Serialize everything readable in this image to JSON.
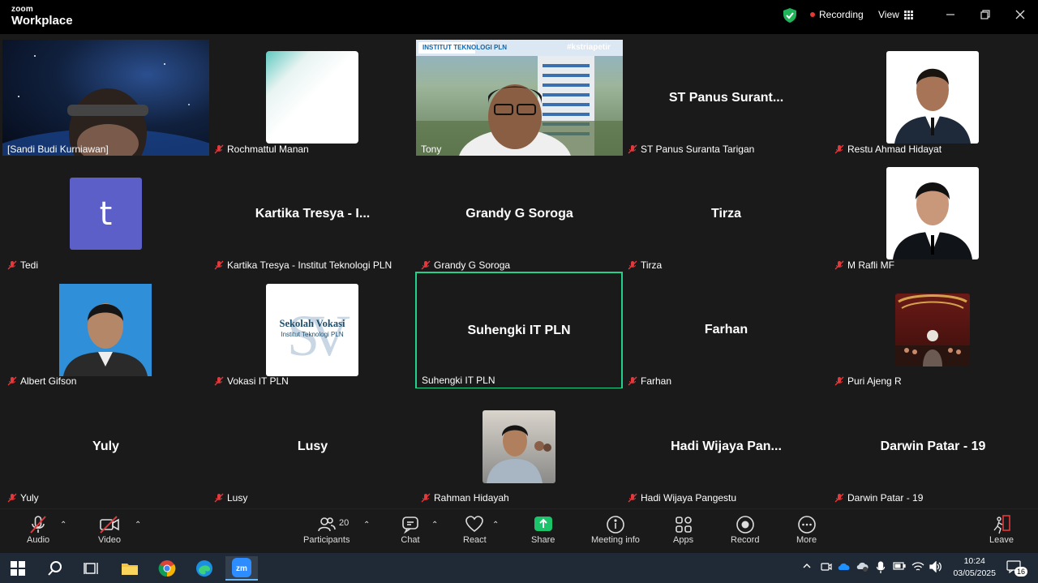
{
  "titlebar": {
    "brand_small": "zoom",
    "brand_large": "Workplace",
    "recording": "Recording",
    "view": "View"
  },
  "tiles": [
    {
      "name": "[Sandi Budi Kurniawan]",
      "big": "",
      "muted": false,
      "kind": "video-space"
    },
    {
      "name": "Rochmattul Manan",
      "big": "",
      "muted": true,
      "kind": "photo-white"
    },
    {
      "name": "Tony",
      "big": "",
      "muted": false,
      "kind": "video-building"
    },
    {
      "name": "ST Panus Suranta Tarigan",
      "big": "ST  Panus  Surant...",
      "muted": true,
      "kind": "name"
    },
    {
      "name": "Restu Ahmad Hidayat",
      "big": "",
      "muted": true,
      "kind": "photo-suit"
    },
    {
      "name": "Tedi",
      "big": "",
      "muted": true,
      "kind": "avatar",
      "avatar_letter": "t"
    },
    {
      "name": "Kartika Tresya - Institut Teknologi PLN",
      "big": "Kartika Tresya - I...",
      "muted": true,
      "kind": "name"
    },
    {
      "name": "Grandy G Soroga",
      "big": "Grandy G Soroga",
      "muted": true,
      "kind": "name"
    },
    {
      "name": "Tirza",
      "big": "Tirza",
      "muted": true,
      "kind": "name"
    },
    {
      "name": "M Rafli MF",
      "big": "",
      "muted": true,
      "kind": "photo-suit2"
    },
    {
      "name": "Albert Gifson",
      "big": "",
      "muted": true,
      "kind": "photo-blue"
    },
    {
      "name": "Vokasi IT PLN",
      "big": "",
      "muted": true,
      "kind": "logo-vokasi",
      "logo_line1": "Sekolah Vokasi",
      "logo_line2": "Institut Teknologi PLN"
    },
    {
      "name": "Suhengki IT PLN",
      "big": "Suhengki IT PLN",
      "muted": false,
      "kind": "name",
      "active": true
    },
    {
      "name": "Farhan",
      "big": "Farhan",
      "muted": true,
      "kind": "name"
    },
    {
      "name": "Puri Ajeng R",
      "big": "",
      "muted": true,
      "kind": "photo-stage"
    },
    {
      "name": "Yuly",
      "big": "Yuly",
      "muted": true,
      "kind": "name"
    },
    {
      "name": "Lusy",
      "big": "Lusy",
      "muted": true,
      "kind": "name"
    },
    {
      "name": "Rahman Hidayah",
      "big": "",
      "muted": true,
      "kind": "photo-group"
    },
    {
      "name": "Hadi Wijaya Pangestu",
      "big": "Hadi Wijaya Pan...",
      "muted": true,
      "kind": "name"
    },
    {
      "name": "Darwin Patar  - 19",
      "big": "Darwin Patar  - 19",
      "muted": true,
      "kind": "name"
    }
  ],
  "tony_overlay": {
    "institute": "INSTITUT TEKNOLOGI PLN",
    "hashtag": "#kstriapetir"
  },
  "toolbar": {
    "audio": "Audio",
    "video": "Video",
    "participants": "Participants",
    "participants_count": "20",
    "chat": "Chat",
    "react": "React",
    "share": "Share",
    "meeting_info": "Meeting info",
    "apps": "Apps",
    "record": "Record",
    "more": "More",
    "leave": "Leave"
  },
  "taskbar": {
    "time": "10:24",
    "date": "03/05/2025",
    "notifications": "16"
  },
  "colors": {
    "active_border": "#23d18b",
    "share_green": "#1bc46b",
    "mute_red": "#e5383b"
  }
}
